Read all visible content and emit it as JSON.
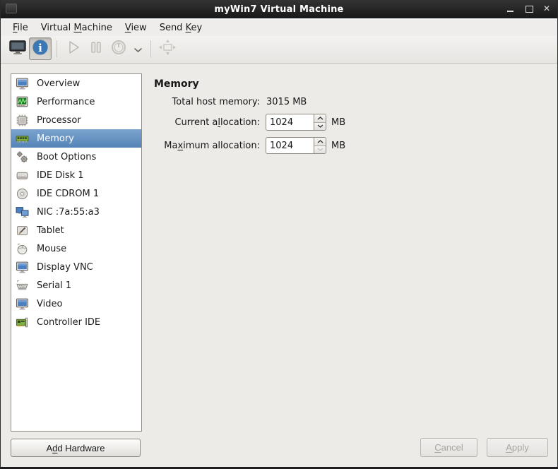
{
  "window": {
    "title": "myWin7 Virtual Machine",
    "titlebar_icons": [
      "app-icon",
      "minimize-icon",
      "maximize-icon",
      "close-icon"
    ]
  },
  "menu": {
    "items": [
      {
        "name": "file",
        "pre": "",
        "key": "F",
        "post": "ile"
      },
      {
        "name": "virtual-machine",
        "pre": "Virtual ",
        "key": "M",
        "post": "achine"
      },
      {
        "name": "view",
        "pre": "",
        "key": "V",
        "post": "iew"
      },
      {
        "name": "send-key",
        "pre": "Send ",
        "key": "K",
        "post": "ey"
      }
    ]
  },
  "toolbar": {
    "buttons": [
      {
        "icon": "console-monitor-icon",
        "state": "enabled"
      },
      {
        "icon": "info-icon",
        "state": "toggled"
      },
      {
        "icon": "play-icon",
        "state": "disabled"
      },
      {
        "icon": "pause-icon",
        "state": "disabled"
      },
      {
        "icon": "power-icon",
        "state": "disabled"
      },
      {
        "icon": "chevron-down-icon",
        "state": "enabled"
      },
      {
        "icon": "fullscreen-move-icon",
        "state": "disabled"
      }
    ]
  },
  "sidebar": {
    "selected_index": 3,
    "items": [
      {
        "icon": "monitor-icon",
        "label": "Overview"
      },
      {
        "icon": "performance-icon",
        "label": "Performance"
      },
      {
        "icon": "processor-icon",
        "label": "Processor"
      },
      {
        "icon": "memory-icon",
        "label": "Memory"
      },
      {
        "icon": "gears-icon",
        "label": "Boot Options"
      },
      {
        "icon": "disk-icon",
        "label": "IDE Disk 1"
      },
      {
        "icon": "cdrom-icon",
        "label": "IDE CDROM 1"
      },
      {
        "icon": "nic-icon",
        "label": "NIC :7a:55:a3"
      },
      {
        "icon": "tablet-icon",
        "label": "Tablet"
      },
      {
        "icon": "mouse-icon",
        "label": "Mouse"
      },
      {
        "icon": "monitor-icon",
        "label": "Display VNC"
      },
      {
        "icon": "serial-icon",
        "label": "Serial 1"
      },
      {
        "icon": "monitor-icon",
        "label": "Video"
      },
      {
        "icon": "controller-icon",
        "label": "Controller IDE"
      }
    ]
  },
  "content": {
    "heading": "Memory",
    "total_host_memory": {
      "label": "Total host memory:",
      "value": "3015 MB"
    },
    "current_allocation": {
      "label_pre": "Current a",
      "label_key": "l",
      "label_post": "location:",
      "value": "1024",
      "unit": "MB"
    },
    "maximum_allocation": {
      "label_pre": "Ma",
      "label_key": "x",
      "label_post": "imum allocation:",
      "value": "1024",
      "unit": "MB"
    }
  },
  "footer": {
    "add_hardware": {
      "pre": "A",
      "key": "d",
      "post": "d Hardware"
    },
    "cancel": {
      "pre": "",
      "key": "C",
      "post": "ancel"
    },
    "apply": {
      "pre": "",
      "key": "A",
      "post": "pply"
    }
  },
  "colors": {
    "titlebar_bg": "#1d1d1d",
    "selection_top": "#7ba3ce",
    "selection_bottom": "#5583b7",
    "info_button_blue": "#3a77b5",
    "window_bg": "#edebe8",
    "sidebar_bg": "#ffffff",
    "disabled_text": "#a9a5a0"
  }
}
